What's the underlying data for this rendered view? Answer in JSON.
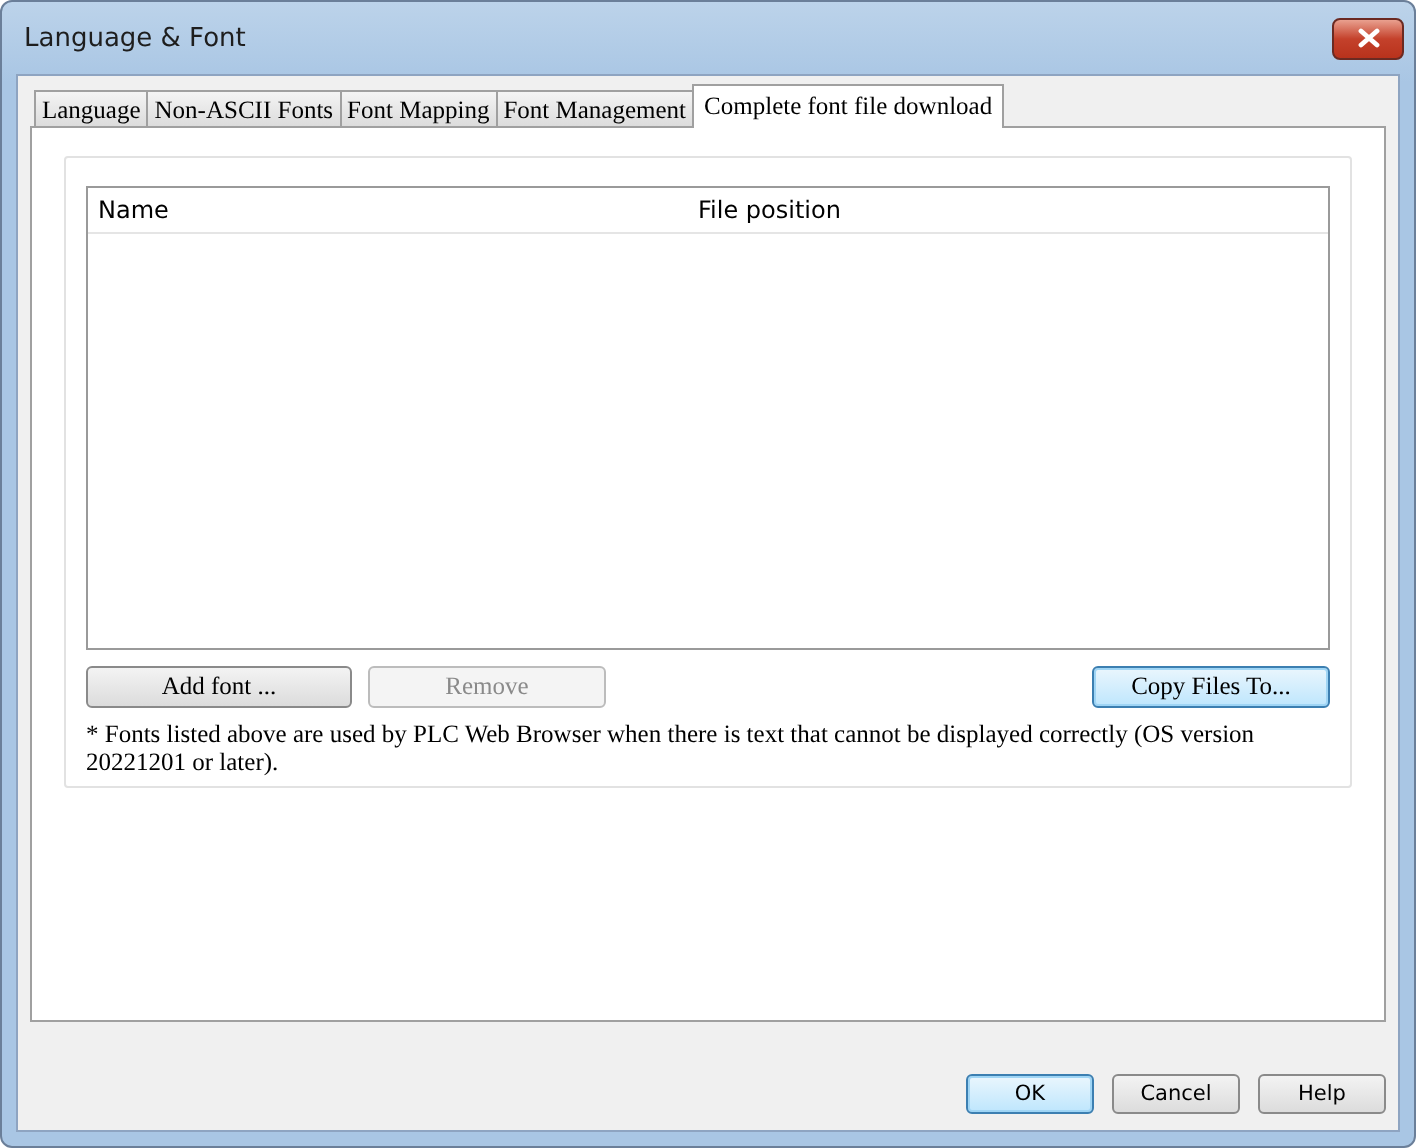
{
  "window": {
    "title": "Language & Font"
  },
  "tabs": [
    {
      "label": "Language",
      "selected": false
    },
    {
      "label": "Non-ASCII Fonts",
      "selected": false
    },
    {
      "label": "Font Mapping",
      "selected": false
    },
    {
      "label": "Font Management",
      "selected": false
    },
    {
      "label": "Complete font file download",
      "selected": true
    }
  ],
  "table": {
    "columns": [
      "Name",
      "File position"
    ]
  },
  "list_buttons": [
    {
      "label": "Add font ...",
      "disabled": false,
      "default": false
    },
    {
      "label": "Remove",
      "disabled": true,
      "default": false
    },
    {
      "label": "Copy Files To...",
      "disabled": false,
      "default": true
    }
  ],
  "note": "* Fonts listed above are used by PLC Web Browser when there is text that cannot be displayed correctly (OS version 20221201 or later).",
  "dialog_buttons": [
    {
      "label": "OK",
      "disabled": false,
      "default": true
    },
    {
      "label": "Cancel",
      "disabled": false,
      "default": false
    },
    {
      "label": "Help",
      "disabled": false,
      "default": false
    }
  ]
}
